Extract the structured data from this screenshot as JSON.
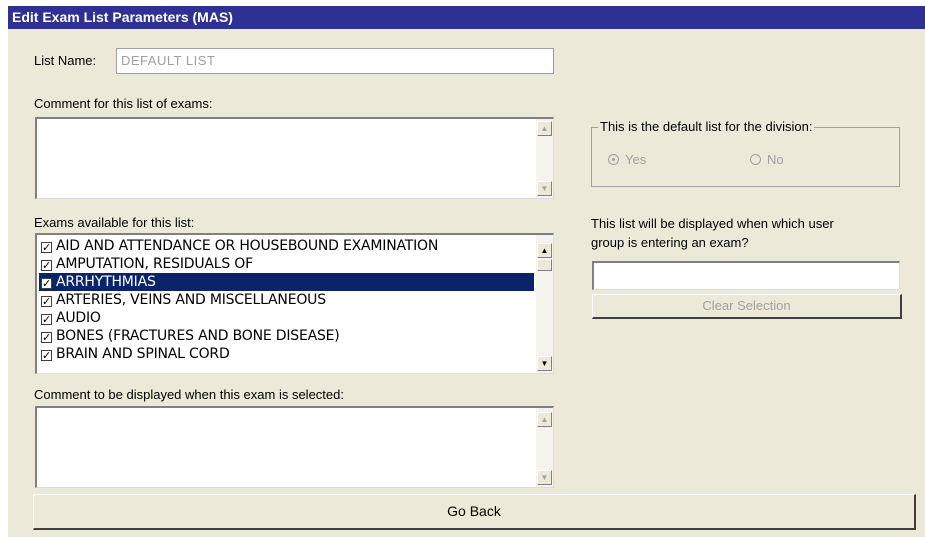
{
  "window": {
    "title": "Edit Exam List Parameters (MAS)"
  },
  "list_name": {
    "label": "List Name:",
    "value": "DEFAULT LIST"
  },
  "comment_list": {
    "label": "Comment for this list of exams:",
    "value": ""
  },
  "exams": {
    "label": "Exams available for this list:",
    "items": [
      {
        "label": "AID AND ATTENDANCE OR HOUSEBOUND EXAMINATION",
        "checked": true,
        "selected": false
      },
      {
        "label": "AMPUTATION, RESIDUALS OF",
        "checked": true,
        "selected": false
      },
      {
        "label": "ARRHYTHMIAS",
        "checked": true,
        "selected": true
      },
      {
        "label": "ARTERIES, VEINS AND MISCELLANEOUS",
        "checked": true,
        "selected": false
      },
      {
        "label": "AUDIO",
        "checked": true,
        "selected": false
      },
      {
        "label": "BONES (FRACTURES AND BONE DISEASE)",
        "checked": true,
        "selected": false
      },
      {
        "label": "BRAIN AND SPINAL CORD",
        "checked": true,
        "selected": false
      }
    ]
  },
  "comment_exam": {
    "label": "Comment to be displayed when this exam is selected:",
    "value": ""
  },
  "default_group": {
    "legend": "This is the default list for the division:",
    "yes_label": "Yes",
    "no_label": "No",
    "selected": "Yes"
  },
  "user_group": {
    "label_line1": "This list will be displayed when which user",
    "label_line2": "group is entering an exam?",
    "value": ""
  },
  "buttons": {
    "clear_selection": "Clear Selection",
    "go_back": "Go Back"
  },
  "colors": {
    "title_bar": "#2f3094",
    "selection": "#0a246a",
    "window_bg": "#ece9d8"
  }
}
